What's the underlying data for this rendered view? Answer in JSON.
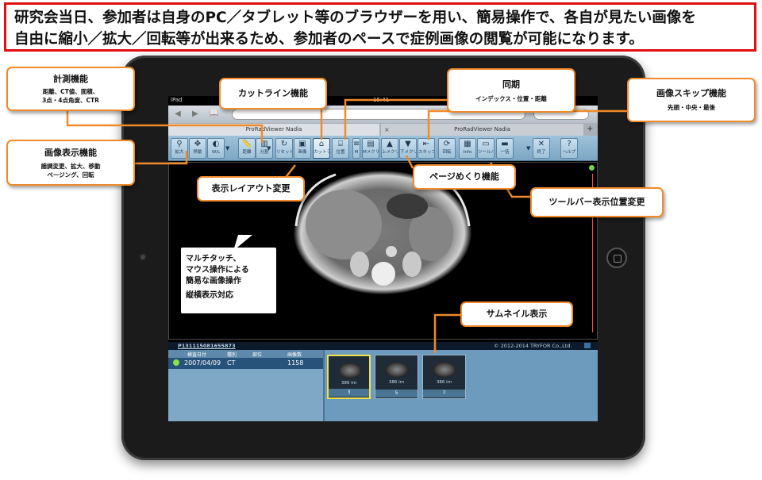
{
  "banner": {
    "line1": "研究会当日、参加者は自身のPC／タブレット等のブラウザーを用い、簡易操作で、各自が見たい画像を",
    "line2": "自由に縮小／拡大／回転等が出来るため、参加者のペースで症例画像の閲覧が可能になります。"
  },
  "device": {
    "carrier": "iPad",
    "time": "15:41"
  },
  "browser": {
    "tab1": "ProRadViewer Nadia",
    "tab2": "ProRadViewer Nadia",
    "tab_close": "×",
    "tab_add": "+",
    "back": "◀",
    "forward": "▶",
    "bookmarks": "📖"
  },
  "toolbar": {
    "buttons": [
      {
        "label": "拡大",
        "icon": "magnify-icon",
        "glyph": "⚲"
      },
      {
        "label": "移動",
        "icon": "move-icon",
        "glyph": "✥"
      },
      {
        "label": "W/L",
        "icon": "window-level-icon",
        "glyph": "◐"
      },
      {
        "label": "距離",
        "icon": "distance-icon",
        "glyph": "📏"
      },
      {
        "label": "分割",
        "icon": "split-icon",
        "glyph": "▥"
      },
      {
        "label": "リセット",
        "icon": "reset-icon",
        "glyph": "↻"
      },
      {
        "label": "画像",
        "icon": "image-icon",
        "glyph": "▣"
      },
      {
        "label": "カットライン",
        "icon": "cutline-icon",
        "glyph": "⌂"
      },
      {
        "label": "位置",
        "icon": "position-icon",
        "glyph": "⌸"
      },
      {
        "label": "M",
        "icon": "menu-icon",
        "glyph": "≡"
      },
      {
        "label": "Mメクリ",
        "icon": "m-page-icon",
        "glyph": "▤"
      },
      {
        "label": "上メクリ",
        "icon": "page-up-icon",
        "glyph": "▲"
      },
      {
        "label": "下メクリ",
        "icon": "page-down-icon",
        "glyph": "▼"
      },
      {
        "label": "スキップ",
        "icon": "skip-icon",
        "glyph": "⇤"
      },
      {
        "label": "回転",
        "icon": "rotate-icon",
        "glyph": "⟳"
      },
      {
        "label": "Info",
        "icon": "info-icon",
        "glyph": "▦"
      },
      {
        "label": "ツールバー",
        "icon": "toolbar-icon",
        "glyph": "▭"
      },
      {
        "label": "一括",
        "icon": "batch-icon",
        "glyph": "▬"
      },
      {
        "label": "終了",
        "icon": "close-icon",
        "glyph": "✕"
      },
      {
        "label": "ヘルプ",
        "icon": "help-icon",
        "glyph": "?"
      }
    ]
  },
  "series": {
    "patient_id": "P131115081655873",
    "copyright": "© 2012-2014 TRYFOR Co.,Ltd.",
    "headers": [
      "検査日付",
      "種別",
      "部位",
      "画像数"
    ],
    "rows": [
      {
        "date": "2007/04/09",
        "modality": "CT",
        "region": "",
        "count": "1158"
      }
    ],
    "thumbnails": [
      {
        "size": "386 im",
        "number": "3"
      },
      {
        "size": "386 im",
        "number": "5"
      },
      {
        "size": "386 im",
        "number": "7"
      }
    ]
  },
  "callouts": {
    "measure": {
      "title": "計測機能",
      "sub1": "距離、CT値、面積、",
      "sub2": "3点・4点角度、CTR"
    },
    "display": {
      "title": "画像表示機能",
      "sub1": "諧調変更、拡大、移動",
      "sub2": "ページング、回転"
    },
    "cutline": {
      "title": "カットライン機能"
    },
    "sync": {
      "title": "同期",
      "sub1": "インデックス・位置・距離"
    },
    "skip": {
      "title": "画像スキップ機能",
      "sub1": "先頭・中央・最後"
    },
    "layout": {
      "title": "表示レイアウト変更"
    },
    "paging": {
      "title": "ページめくり機能"
    },
    "toolbar_pos": {
      "title": "ツールバー表示位置変更"
    },
    "thumbnail": {
      "title": "サムネイル表示"
    }
  },
  "speech": {
    "line1": "マルチタッチ、",
    "line2": "マウス操作による",
    "line3": "簡易な画像操作",
    "line4": "縦横表示対応"
  },
  "colors": {
    "banner_border": "#e01010",
    "callout_border": "#f08a2a",
    "toolbar": "#9fc2da",
    "panel": "#6d9bbd"
  }
}
